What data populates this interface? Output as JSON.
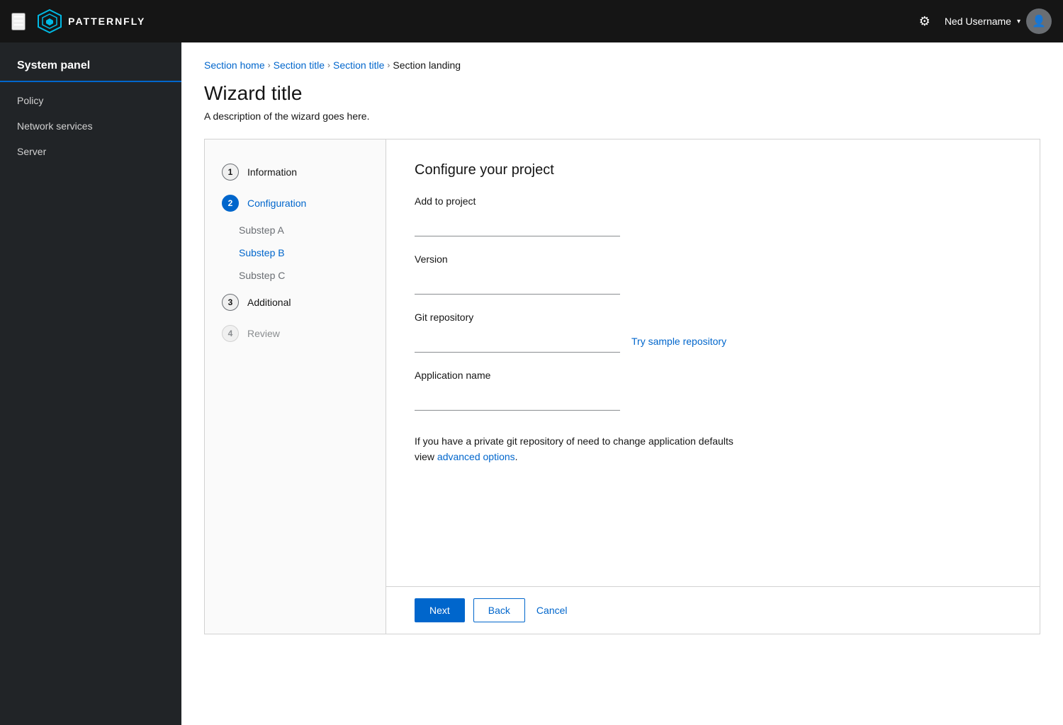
{
  "topnav": {
    "logo_text": "PATTERNFLY",
    "gear_label": "Settings",
    "user_name": "Ned Username",
    "user_chevron": "▾"
  },
  "sidebar": {
    "title": "System panel",
    "items": [
      {
        "label": "Policy"
      },
      {
        "label": "Network services"
      },
      {
        "label": "Server"
      }
    ]
  },
  "breadcrumb": {
    "items": [
      {
        "label": "Section home",
        "link": true
      },
      {
        "label": "Section title",
        "link": true
      },
      {
        "label": "Section title",
        "link": true
      },
      {
        "label": "Section landing",
        "link": false
      }
    ]
  },
  "page": {
    "title": "Wizard title",
    "description": "A description of the wizard goes here."
  },
  "wizard": {
    "steps": [
      {
        "num": "1",
        "label": "Information",
        "state": "default"
      },
      {
        "num": "2",
        "label": "Configuration",
        "state": "active",
        "substeps": [
          {
            "label": "Substep A",
            "state": "inactive"
          },
          {
            "label": "Substep B",
            "state": "active"
          },
          {
            "label": "Substep C",
            "state": "inactive"
          }
        ]
      },
      {
        "num": "3",
        "label": "Additional",
        "state": "default"
      },
      {
        "num": "4",
        "label": "Review",
        "state": "disabled"
      }
    ],
    "section_title": "Configure your project",
    "form": {
      "add_to_project_label": "Add to project",
      "add_to_project_value": "",
      "version_label": "Version",
      "version_value": "",
      "git_repository_label": "Git repository",
      "git_repository_value": "",
      "try_sample_link": "Try sample repository",
      "application_name_label": "Application name",
      "application_name_value": "",
      "info_text_before": "If you have a private git repository of need to change application defaults view ",
      "info_link": "advanced options",
      "info_text_after": "."
    },
    "footer": {
      "next_label": "Next",
      "back_label": "Back",
      "cancel_label": "Cancel"
    }
  }
}
